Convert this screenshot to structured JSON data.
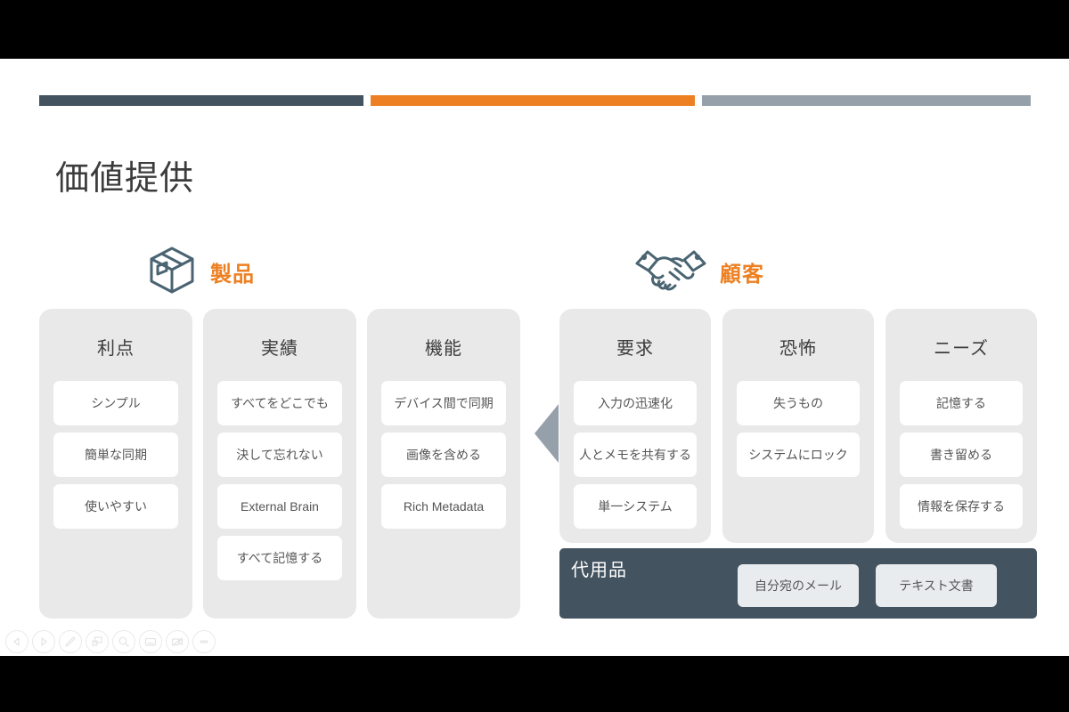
{
  "slide": {
    "title": "価値提供",
    "accent_bars": [
      {
        "name": "dark",
        "color": "#435360"
      },
      {
        "name": "orange",
        "color": "#ED8022"
      },
      {
        "name": "gray",
        "color": "#96A0AA"
      }
    ],
    "sections": [
      {
        "key": "product",
        "label": "製品",
        "icon": "box-icon",
        "color": "#ED8022"
      },
      {
        "key": "customer",
        "label": "顧客",
        "icon": "handshake-icon",
        "color": "#ED8022"
      }
    ],
    "columns": [
      {
        "title": "利点",
        "items": [
          "シンプル",
          "簡単な同期",
          "使いやすい"
        ]
      },
      {
        "title": "実績",
        "items": [
          "すべてをどこでも",
          "決して忘れない",
          "External Brain",
          "すべて記憶する"
        ]
      },
      {
        "title": "機能",
        "items": [
          "デバイス間で同期",
          "画像を含める",
          "Rich Metadata"
        ]
      },
      {
        "title": "要求",
        "items": [
          "入力の迅速化",
          "人とメモを共有する",
          "単一システム"
        ]
      },
      {
        "title": "恐怖",
        "items": [
          "失うもの",
          "システムにロック"
        ]
      },
      {
        "title": "ニーズ",
        "items": [
          "記憶する",
          "書き留める",
          "情報を保存する"
        ]
      }
    ],
    "substitutes": {
      "label": "代用品",
      "items": [
        "自分宛のメール",
        "テキスト文書"
      ],
      "background": "#435360"
    }
  },
  "presenter_toolbar": {
    "buttons": [
      {
        "name": "previous-slide-button",
        "icon": "triangle-left-icon"
      },
      {
        "name": "next-slide-button",
        "icon": "triangle-right-icon"
      },
      {
        "name": "annotate-button",
        "icon": "pen-icon"
      },
      {
        "name": "slide-overview-button",
        "icon": "slides-icon"
      },
      {
        "name": "zoom-button",
        "icon": "magnifier-icon"
      },
      {
        "name": "captions-button",
        "icon": "caption-icon"
      },
      {
        "name": "camera-off-button",
        "icon": "video-off-icon"
      },
      {
        "name": "more-options-button",
        "icon": "ellipsis-icon"
      }
    ]
  }
}
